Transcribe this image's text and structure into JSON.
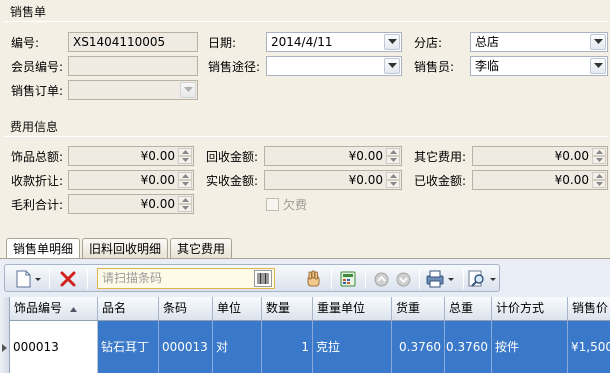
{
  "sales_group": {
    "title": "销售单",
    "order_no_label": "编号:",
    "order_no_value": "XS1404110005",
    "date_label": "日期:",
    "date_value": "2014/4/11",
    "branch_label": "分店:",
    "branch_value": "总店",
    "member_no_label": "会员编号:",
    "member_no_value": "",
    "channel_label": "销售途径:",
    "channel_value": "",
    "salesperson_label": "销售员:",
    "salesperson_value": "李临",
    "sales_order_label": "销售订单:",
    "sales_order_value": ""
  },
  "fees_group": {
    "title": "费用信息",
    "jewelry_total_label": "饰品总额:",
    "jewelry_total_value": "¥0.00",
    "recycle_amount_label": "回收金额:",
    "recycle_amount_value": "¥0.00",
    "other_fees_label": "其它费用:",
    "other_fees_value": "¥0.00",
    "discount_label": "收款折让:",
    "discount_value": "¥0.00",
    "actual_received_label": "实收金额:",
    "actual_received_value": "¥0.00",
    "received_label": "已收金额:",
    "received_value": "¥0.00",
    "gross_profit_label": "毛利合计:",
    "gross_profit_value": "¥0.00",
    "owing_label": "欠费",
    "owing_checked": false
  },
  "tabs": [
    {
      "label": "销售单明细",
      "active": true
    },
    {
      "label": "旧料回收明细",
      "active": false
    },
    {
      "label": "其它费用",
      "active": false
    }
  ],
  "toolbar": {
    "scan_placeholder": "请扫描条码",
    "icons": [
      "new-document-icon",
      "delete-icon",
      "barcode-icon",
      "hand-icon",
      "calculator-icon",
      "up-circle-icon",
      "down-circle-icon",
      "print-icon",
      "search-icon"
    ]
  },
  "grid": {
    "columns": [
      "饰品编号",
      "品名",
      "条码",
      "单位",
      "数量",
      "重量单位",
      "货重",
      "总重",
      "计价方式",
      "销售价"
    ],
    "rows": [
      [
        "000013",
        "钻石耳丁",
        "000013",
        "对",
        "1",
        "克拉",
        "0.3760",
        "0.3760",
        "按件",
        "¥1,500"
      ]
    ],
    "selected_row_color": "#3a79c9"
  }
}
